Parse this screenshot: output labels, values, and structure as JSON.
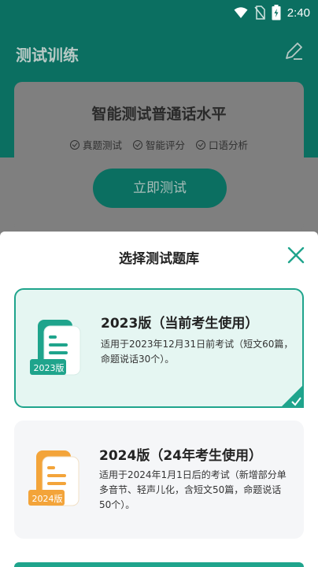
{
  "status_bar": {
    "time": "2:40"
  },
  "header": {
    "title": "测试训练"
  },
  "test_card": {
    "title": "智能测试普通话水平",
    "features": [
      "真题测试",
      "智能评分",
      "口语分析"
    ],
    "start_label": "立即测试"
  },
  "sheet": {
    "title": "选择测试题库",
    "banks": [
      {
        "badge": "2023版",
        "name": "2023版（当前考生使用）",
        "desc": "适用于2023年12月31日前考试（短文60篇，命题说话30个）。",
        "selected": true
      },
      {
        "badge": "2024版",
        "name": "2024版（24年考生使用）",
        "desc": "适用于2024年1月1日后的考试（新增部分单多音节、轻声儿化，含短文50篇，命题说话50个）。",
        "selected": false
      }
    ]
  },
  "colors": {
    "primary": "#1fa48c",
    "primary_dark": "#0b6f61",
    "orange": "#f3a43a",
    "selected_bg": "#e5f6f2"
  }
}
